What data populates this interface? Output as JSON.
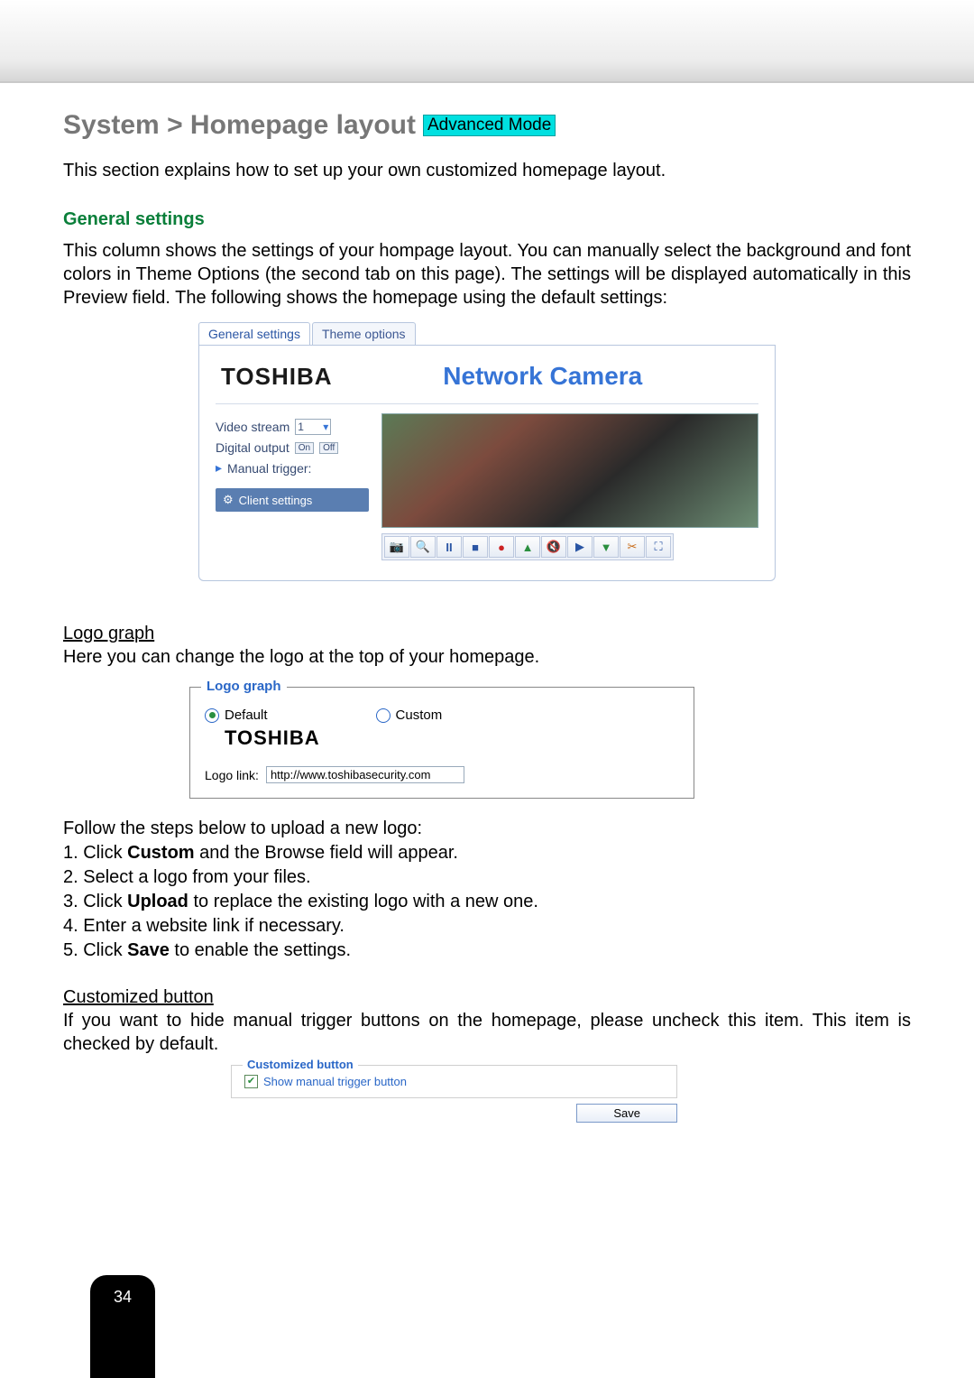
{
  "page_number": "34",
  "title_prefix": "System > Homepage layout",
  "mode_badge": "Advanced Mode",
  "intro": "This section explains how to set up your own customized homepage layout.",
  "general_heading": "General settings",
  "general_para": "This column shows the settings of your hompage layout. You can manually select the background and font colors in Theme Options (the second tab on this page). The settings will be displayed automatically in this Preview field. The following shows the homepage using the default settings:",
  "preview": {
    "tabs": {
      "general": "General settings",
      "theme": "Theme options"
    },
    "brand": "TOSHIBA",
    "product": "Network Camera",
    "side": {
      "video_stream_label": "Video stream",
      "video_stream_value": "1",
      "digital_output_label": "Digital output",
      "do_on": "On",
      "do_off": "Off",
      "manual_trigger_label": "Manual trigger:",
      "client_settings_label": "Client settings"
    }
  },
  "logo_graph": {
    "underline": "Logo graph",
    "intro": "Here you can change the logo at the top of your homepage.",
    "legend": "Logo graph",
    "default_label": "Default",
    "custom_label": "Custom",
    "brand": "TOSHIBA",
    "link_label": "Logo link:",
    "link_value": "http://www.toshibasecurity.com"
  },
  "steps_intro": "Follow the steps below to upload a new logo:",
  "steps": [
    {
      "n": "1. Click ",
      "b": "Custom",
      "rest": " and the Browse field will appear."
    },
    {
      "n": "2. Select a logo from your files.",
      "b": "",
      "rest": ""
    },
    {
      "n": "3. Click ",
      "b": "Upload",
      "rest": " to replace the existing logo with a new one."
    },
    {
      "n": "4. Enter a website link if necessary.",
      "b": "",
      "rest": ""
    },
    {
      "n": "5. Click ",
      "b": "Save",
      "rest": " to enable the settings."
    }
  ],
  "custom_btn": {
    "underline": "Customized button",
    "para": "If you want to hide manual trigger buttons on the homepage, please uncheck this item. This item is checked by default.",
    "legend": "Customized button",
    "checkbox_label": "Show manual trigger button",
    "save": "Save"
  }
}
